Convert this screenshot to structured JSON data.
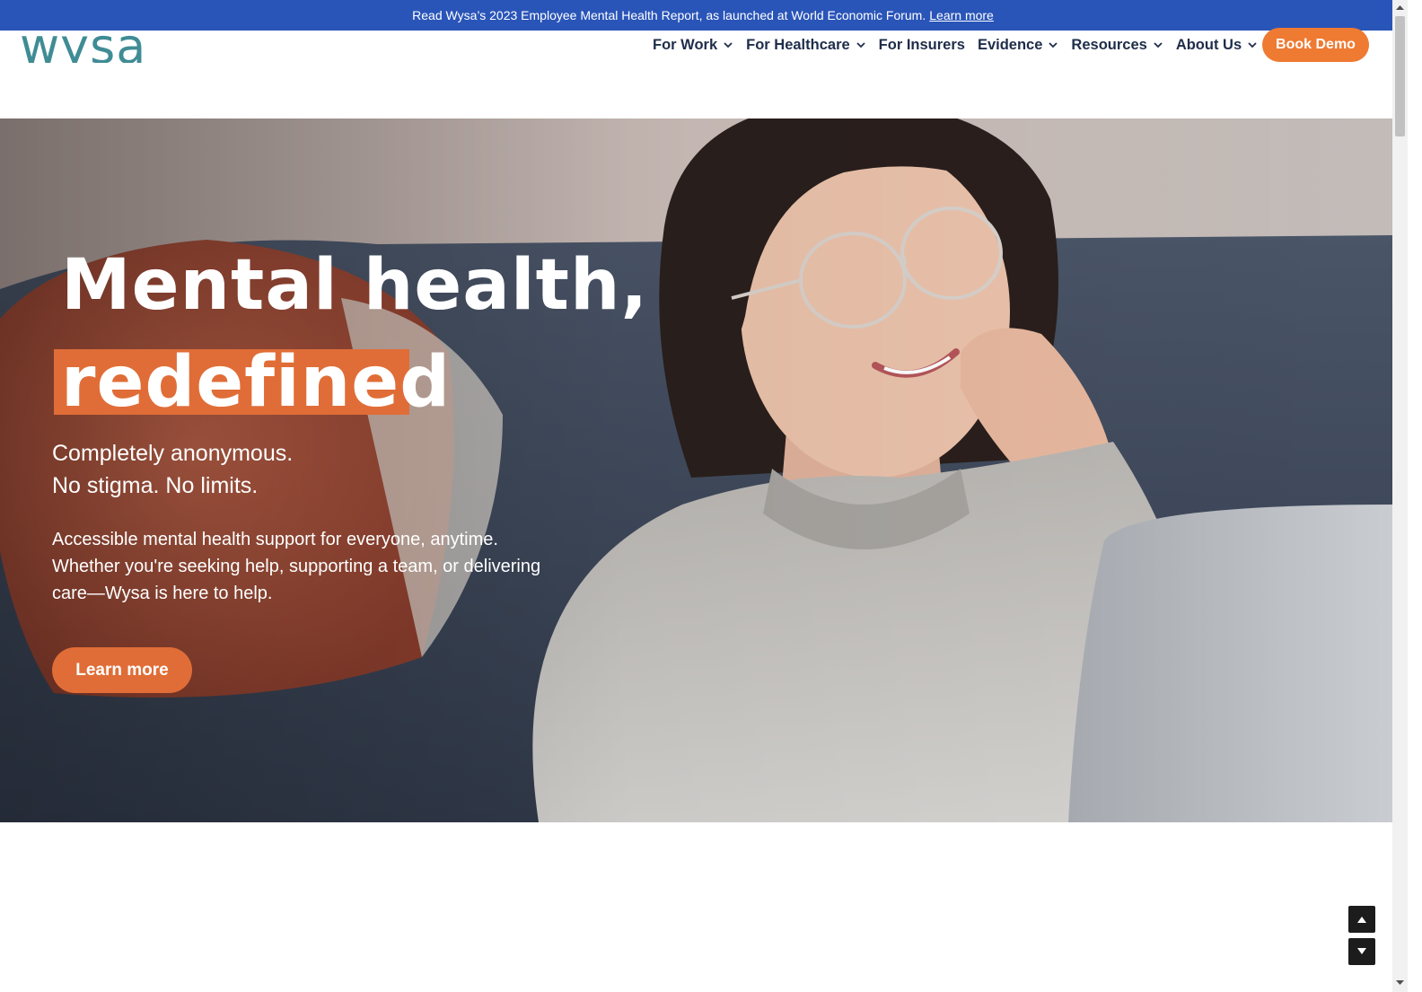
{
  "announcement": {
    "text": "Read Wysa’s 2023 Employee Mental Health Report, as launched at World Economic Forum.",
    "link": "Learn more"
  },
  "header": {
    "logo_text": "wysa",
    "nav": [
      {
        "label": "For Work",
        "icon": "chevron-down-icon"
      },
      {
        "label": "For Healthcare",
        "icon": "chevron-down-icon"
      },
      {
        "label": "For Insurers"
      },
      {
        "label": "Evidence",
        "icon": "chevron-down-icon"
      },
      {
        "label": "Resources",
        "icon": "chevron-down-icon"
      },
      {
        "label": "About Us",
        "icon": "chevron-down-icon"
      }
    ],
    "cta": "Book Demo"
  },
  "hero": {
    "heading_line1": "Mental health,",
    "heading_line2": "redefined",
    "tagline_line1": "Completely anonymous.",
    "tagline_line2": "No stigma. No limits.",
    "description": "Accessible mental health support for everyone, anytime. Whether you're seeking help, supporting a team, or delivering care—Wysa is here to help.",
    "button": "Learn more"
  },
  "colors": {
    "announcement_bg": "#2a55b8",
    "brand_teal": "#3f8c95",
    "nav_text": "#1f2d4a",
    "accent_orange": "#ef7a32",
    "hero_highlight": "#e06d37"
  },
  "floating_controls": {
    "up": "scroll-up-icon",
    "down": "scroll-down-icon"
  }
}
